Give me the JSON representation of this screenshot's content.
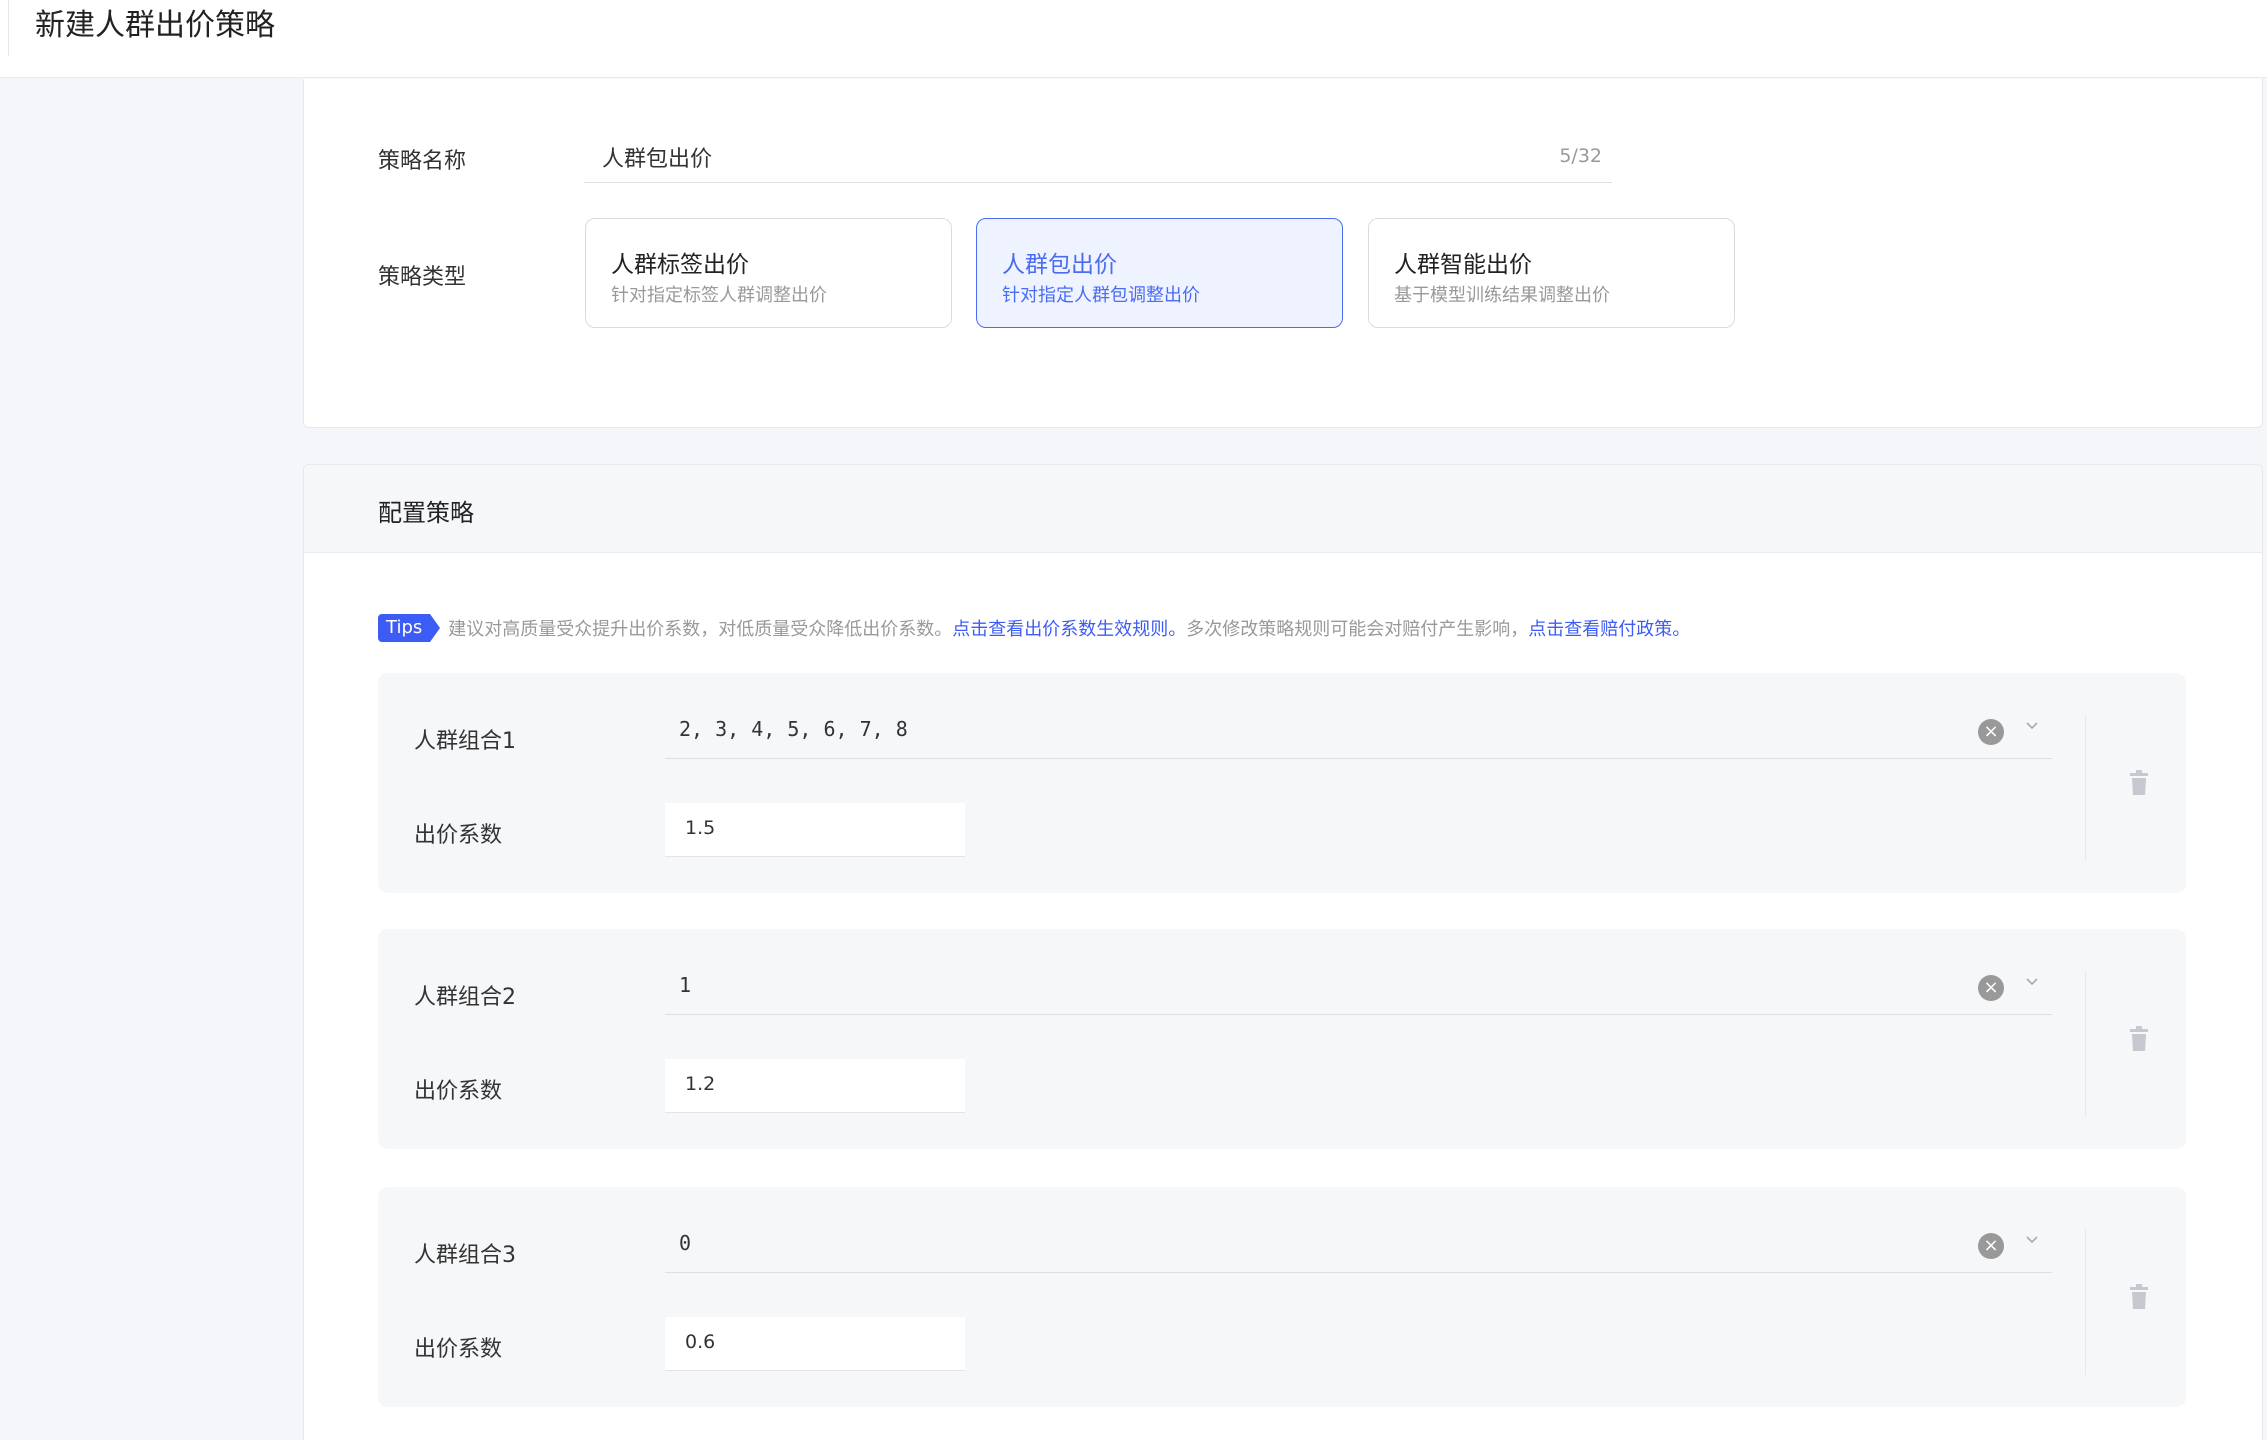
{
  "header": {
    "title": "新建人群出价策略"
  },
  "basic": {
    "name_label": "策略名称",
    "name_value": "人群包出价",
    "name_count": "5/32",
    "type_label": "策略类型",
    "types": [
      {
        "title": "人群标签出价",
        "desc": "针对指定标签人群调整出价"
      },
      {
        "title": "人群包出价",
        "desc": "针对指定人群包调整出价"
      },
      {
        "title": "人群智能出价",
        "desc": "基于模型训练结果调整出价"
      }
    ]
  },
  "config": {
    "title": "配置策略",
    "tips": {
      "badge": "Tips",
      "text1": "建议对高质量受众提升出价系数，对低质量受众降低出价系数。",
      "link1": "点击查看出价系数生效规则。",
      "text2": "多次修改策略规则可能会对赔付产生影响，",
      "link2": "点击查看赔付政策。"
    },
    "groups": [
      {
        "label": "人群组合1",
        "value": "2, 3, 4, 5, 6, 7, 8",
        "coef_label": "出价系数",
        "coef": "1.5"
      },
      {
        "label": "人群组合2",
        "value": "1",
        "coef_label": "出价系数",
        "coef": "1.2"
      },
      {
        "label": "人群组合3",
        "value": "0",
        "coef_label": "出价系数",
        "coef": "0.6"
      }
    ]
  },
  "colors": {
    "accent": "#3d5cf5",
    "active_bg": "#eff3ff"
  },
  "icons": {
    "clear": "close-circle-icon",
    "dropdown": "chevron-down-icon",
    "delete": "trash-icon"
  }
}
